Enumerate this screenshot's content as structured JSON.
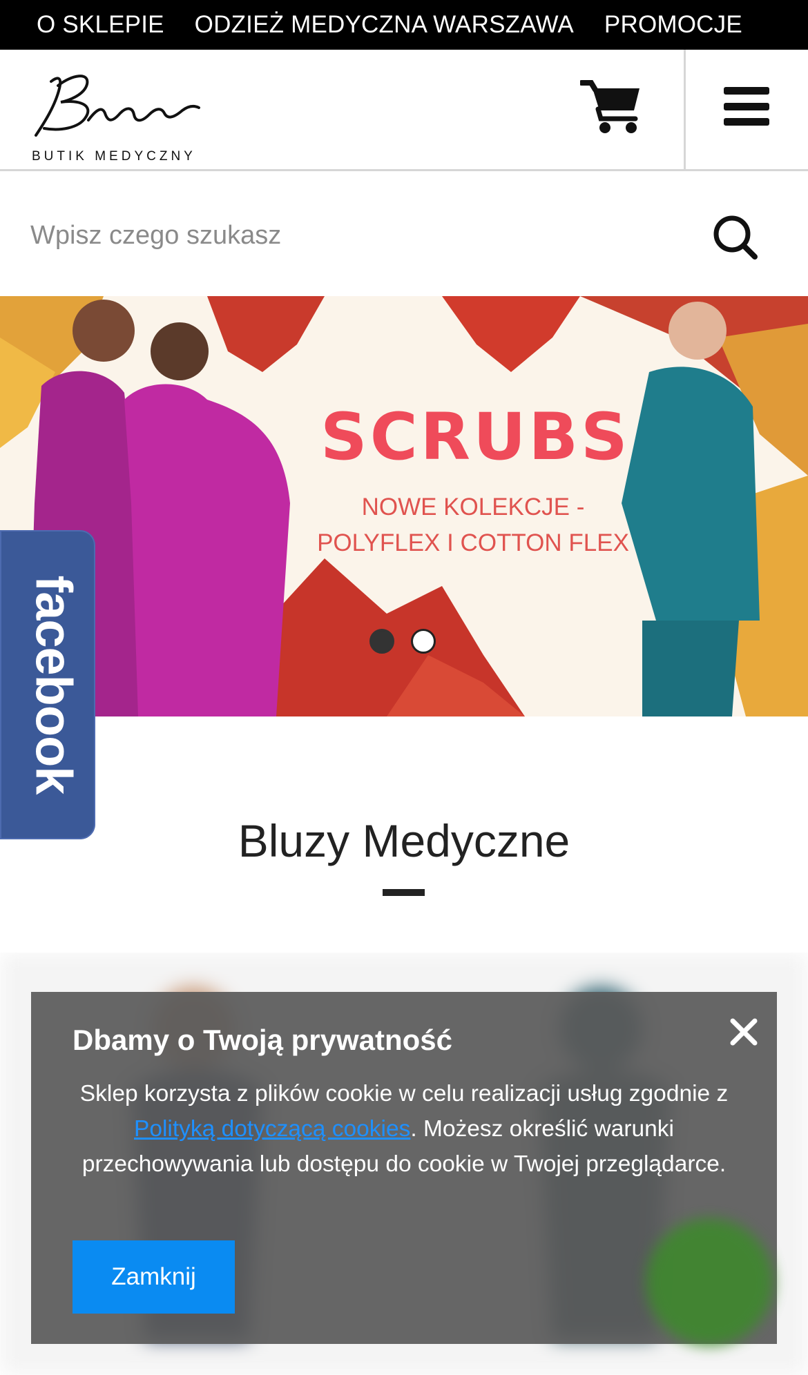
{
  "topnav": {
    "items": [
      "O SKLEPIE",
      "ODZIEŻ MEDYCZNA WARSZAWA",
      "PROMOCJE"
    ]
  },
  "header": {
    "logo_text": "BUTIK MEDYCZNY",
    "cart_icon": "cart-icon",
    "menu_icon": "hamburger-icon"
  },
  "search": {
    "placeholder": "Wpisz czego szukasz",
    "icon": "search-icon"
  },
  "banner": {
    "title": "SCRUBS",
    "subtitle_line1": "NOWE KOLEKCJE -",
    "subtitle_line2": "POLYFLEX I COTTON FLEX",
    "slides_total": 2,
    "active_slide": 1
  },
  "facebook_tab": {
    "label": "facebook"
  },
  "section": {
    "title": "Bluzy Medyczne"
  },
  "cookie": {
    "title": "Dbamy o Twoją prywatność",
    "text_before": "Sklep korzysta z plików cookie w celu realizacji usług zgodnie z ",
    "link_text": "Polityką dotyczącą cookies",
    "text_after": ". Możesz określić warunki przechowywania lub dostępu do cookie w Twojej przeglądarce.",
    "button_label": "Zamknij",
    "close_icon": "close-icon"
  },
  "colors": {
    "topnav_bg": "#000000",
    "banner_title": "#ef4b5a",
    "facebook_blue": "#3b5998",
    "cookie_button": "#0a8bf2",
    "cookie_link": "#1e90ff"
  }
}
